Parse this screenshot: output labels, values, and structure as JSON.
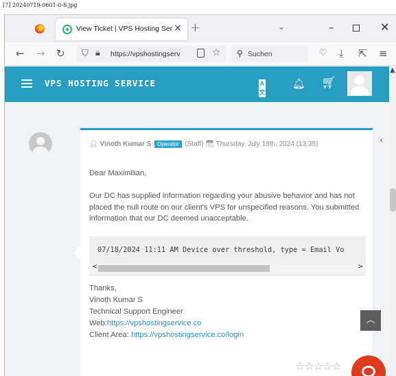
{
  "file_caption": "[7] 20240719-0601-0-8.jpg",
  "browser": {
    "tab_title": "View Ticket | VPS Hosting Servic",
    "close_glyph": "×",
    "new_tab_glyph": "+",
    "tab_list_glyph": "⌄",
    "minimize_glyph": "–",
    "close_window_glyph": "✕",
    "back_glyph": "←",
    "forward_glyph": "→",
    "reload_glyph": "↻",
    "url": "https://vpshostingserv",
    "star_glyph": "☆",
    "search_placeholder": "Suchen",
    "pocket_glyph": "♡",
    "download_glyph": "⤓",
    "extensions_glyph": "⇱",
    "menu_glyph": "≡"
  },
  "site": {
    "brand": "VPS HOSTING SERVICE",
    "translate_a": "A",
    "translate_b": "文"
  },
  "ticket": {
    "author": "Vinoth Kumar S",
    "role_badge": "Operator",
    "staff_label": "(Staff)",
    "date": "Thursday, July 18th, 2024 (13:35)",
    "greeting": "Dear Maximilian,",
    "body": "Our DC has supplied information regarding your abusive behavior and has not placed the null route on our client's VPS for unspecified reasons. You submitted information that our DC deemed unacceptable.",
    "code": "07/18/2024 11:11 AM Device over threshold, type = Email Vo",
    "signature": {
      "thanks": "Thanks,",
      "name": "Vinoth Kumar S",
      "title": "Technical Support Engineer",
      "web_label": "Web:",
      "web_url": "https://vpshostingservice.co",
      "client_label": "Client Area: ",
      "client_url": "https://vpshostingservice.co/login"
    },
    "rating_stars": "☆☆☆☆☆"
  },
  "ui": {
    "scroll_up_glyph": "▲",
    "code_left_glyph": "<",
    "code_right_glyph": ">",
    "to_top_glyph": "︿",
    "side_toggle_glyph": "‹"
  },
  "colors": {
    "brand": "#279ec2",
    "chat": "#dd3a1f",
    "link": "#2a8fbd"
  }
}
